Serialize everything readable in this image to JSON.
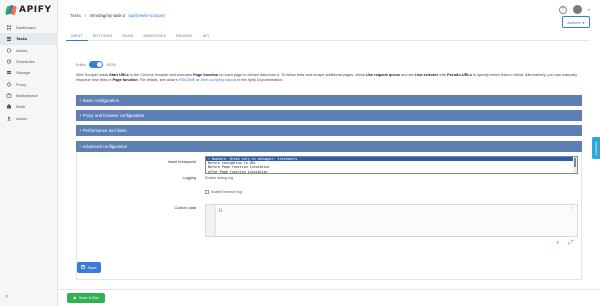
{
  "brand": {
    "name": "APIFY",
    "colors": [
      "#ff6c41",
      "#2fb14f",
      "#3a7bd5"
    ]
  },
  "sidebar": {
    "items": [
      {
        "label": "Dashboard",
        "icon": "dashboard-icon"
      },
      {
        "label": "Tasks",
        "icon": "tasks-icon",
        "active": true
      },
      {
        "label": "Actors",
        "icon": "actors-icon"
      },
      {
        "label": "Schedules",
        "icon": "schedules-icon"
      },
      {
        "label": "Storage",
        "icon": "storage-icon"
      },
      {
        "label": "Proxy",
        "icon": "proxy-icon"
      },
      {
        "label": "Marketplace",
        "icon": "marketplace-icon"
      },
      {
        "label": "Work",
        "icon": "work-icon"
      },
      {
        "label": "Admin",
        "icon": "admin-icon"
      }
    ],
    "collapse_label": "«"
  },
  "header": {
    "breadcrumb_root": "Tasks",
    "breadcrumb_sep": ">",
    "task_name": "mmrdng/my-task-2",
    "actor_link": "(apify/web-scraper)",
    "help_label": "?",
    "actions_label": "Actions",
    "actions_caret": "▾",
    "avatar_caret": "▾"
  },
  "tabs": [
    "INPUT",
    "SETTINGS",
    "RUNS",
    "WEBHOOKS",
    "README",
    "API"
  ],
  "active_tab": "INPUT",
  "editor_toggle": {
    "left": "Editor",
    "right": "JSON",
    "state": "json"
  },
  "description": {
    "p1": "Web Scraper loads ",
    "b1": "Start URLs",
    "p2": " in the Chrome browser and executes ",
    "b2": "Page function",
    "p3": " on each page to extract data from it. To follow links and scrape additional pages, check ",
    "b3": "Use request queue",
    "p4": " and set ",
    "b4": "Link selector",
    "p5": " with ",
    "b5": "Pseudo-URLs",
    "p6": " to specify which links to follow. Alternatively, you can manually enqueue new links in ",
    "b6": "Page function",
    "p7": ". For details, see actor's ",
    "a1": "README",
    "p8": " or ",
    "a2": "Web scraping tutorial",
    "p9": " in the Apify Documentation."
  },
  "sections": [
    "+ Basic configuration",
    "+ Proxy and browser configuration",
    "+ Performance and limits",
    "– Advanced configuration"
  ],
  "advanced": {
    "insert_breakpoint_label": "Insert breakpoint",
    "breakpoint_options": [
      "✓ Nowhere. Break only on debugger; statements",
      "  Before navigation to URL",
      "  Before Page function invocation",
      "  After Page function invocation"
    ],
    "logging_label": "Logging",
    "enable_debug_log": "Enable debug log",
    "enable_browser_log": "Enable browser log",
    "custom_data_label": "Custom data",
    "custom_data_value": "{}",
    "json_more": "⋮"
  },
  "editor_tools": {
    "zoom": "⌕",
    "fullscreen": "⤢"
  },
  "save_label": "Save",
  "run_label": "Save & Run",
  "feedback_label": "Feedback"
}
